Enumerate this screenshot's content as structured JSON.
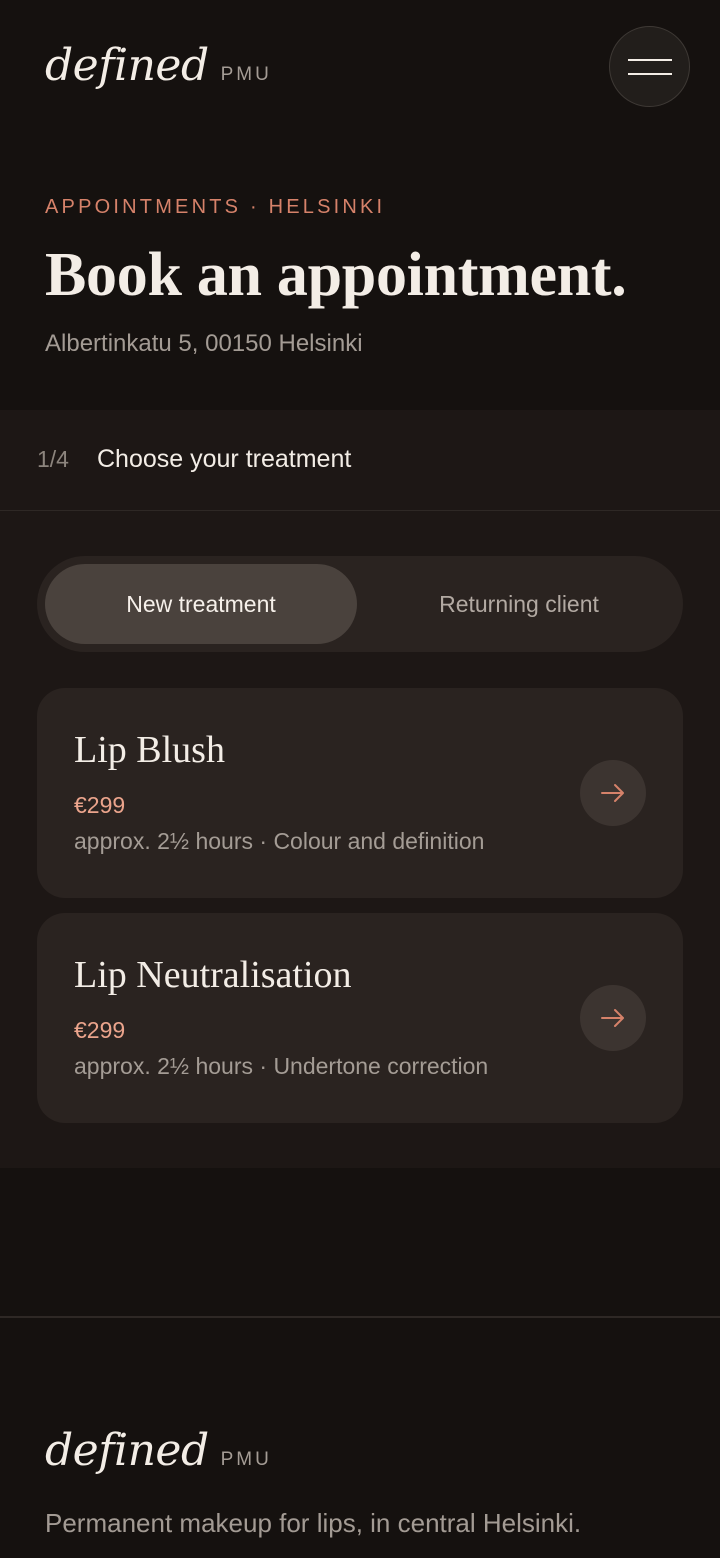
{
  "brand": {
    "name": "defined",
    "suffix": "PMU"
  },
  "header": {
    "menu_icon": "hamburger-menu-icon"
  },
  "hero": {
    "eyebrow": "APPOINTMENTS · HELSINKI",
    "title": "Book an appointment.",
    "address": "Albertinkatu 5, 00150 Helsinki"
  },
  "step": {
    "counter": "1/4",
    "title": "Choose your treatment"
  },
  "client_toggle": {
    "options": [
      "New treatment",
      "Returning client"
    ],
    "selected": "New treatment"
  },
  "treatments": [
    {
      "name": "Lip Blush",
      "price": "€299",
      "meta": "approx. 2½ hours · Colour and definition",
      "icon": "arrow-right-icon"
    },
    {
      "name": "Lip Neutralisation",
      "price": "€299",
      "meta": "approx. 2½ hours · Undertone correction",
      "icon": "arrow-right-icon"
    }
  ],
  "footer": {
    "brand": {
      "name": "defined",
      "suffix": "PMU"
    },
    "tagline": "Permanent makeup for lips, in central Helsinki."
  },
  "colors": {
    "background": "#15110f",
    "panel": "#1d1715",
    "card": "#2a2320",
    "accent": "#d6826a",
    "price": "#eba48c",
    "text": "#f3ede6",
    "muted": "#a39b94"
  }
}
